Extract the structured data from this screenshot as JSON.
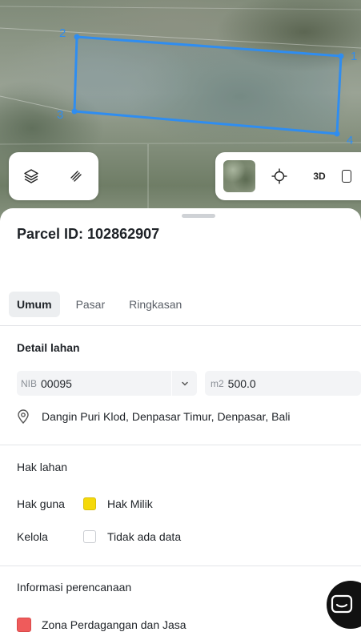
{
  "map": {
    "vertices": [
      "1",
      "2",
      "3",
      "4"
    ],
    "polygon_color": "#2f8df0"
  },
  "map_toolbar": {
    "left_icons": [
      "layers-icon",
      "measure-icon"
    ],
    "right_icons": [
      "satellite-thumbnail",
      "locate-icon",
      "3d-toggle"
    ],
    "btn_3d_label": "3D"
  },
  "parcel": {
    "title": "Parcel ID: 102862907"
  },
  "tabs": [
    {
      "label": "Umum",
      "active": true
    },
    {
      "label": "Pasar",
      "active": false
    },
    {
      "label": "Ringkasan",
      "active": false
    }
  ],
  "detail_lahan": {
    "title": "Detail lahan",
    "nib_prefix": "NIB",
    "nib_value": "00095",
    "area_prefix": "m2",
    "area_value": "500.0",
    "address": "Dangin Puri Klod, Denpasar Timur, Denpasar, Bali"
  },
  "hak_lahan": {
    "title": "Hak lahan",
    "rows": [
      {
        "label": "Hak guna",
        "value": "Hak Milik",
        "color": "#f5d90a"
      },
      {
        "label": "Kelola",
        "value": "Tidak ada data",
        "color": "#ffffff"
      }
    ]
  },
  "perencanaan": {
    "title": "Informasi perencanaan",
    "zone": "Zona Perdagangan dan Jasa",
    "zone_color": "#ef5b5b"
  }
}
